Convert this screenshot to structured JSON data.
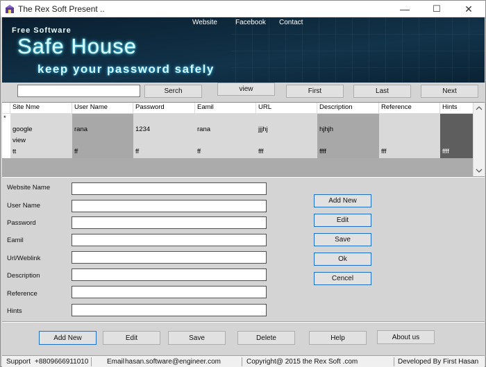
{
  "window": {
    "title": "The Rex Soft Present ..",
    "controls": {
      "minimize": "—",
      "maximize": "☐",
      "close": "✕"
    }
  },
  "banner": {
    "nav": [
      "Website",
      "Facebook",
      "Contact"
    ],
    "free_software": "Free Software",
    "title": "Safe House",
    "tagline": "keep your password safely"
  },
  "search": {
    "value": "",
    "search_label": "Serch",
    "view_label": "view",
    "first_label": "First",
    "last_label": "Last",
    "next_label": "Next"
  },
  "grid": {
    "columns": [
      "Site Nme",
      "User Name",
      "Password",
      "Eamil",
      "URL",
      "Description",
      "Reference",
      "Hints"
    ],
    "new_row_marker": "*",
    "rows": [
      [
        "google",
        "rana",
        "1234",
        "rana",
        "jjjhj",
        "hjhjh",
        "",
        ""
      ],
      [
        "view",
        "",
        "",
        "",
        "",
        "",
        "",
        ""
      ],
      [
        "tt",
        "ff",
        "ff",
        "ff",
        "fff",
        "ffff",
        "fff",
        "ffff"
      ]
    ]
  },
  "form": {
    "fields": [
      {
        "label": "Website Name",
        "value": ""
      },
      {
        "label": "User Name",
        "value": ""
      },
      {
        "label": "Password",
        "value": ""
      },
      {
        "label": "Eamil",
        "value": ""
      },
      {
        "label": "Url/Weblink",
        "value": ""
      },
      {
        "label": "Description",
        "value": ""
      },
      {
        "label": "Reference",
        "value": ""
      },
      {
        "label": "Hints",
        "value": ""
      }
    ],
    "side_buttons": [
      "Add New",
      "Edit",
      "Save",
      "Ok",
      "Cencel"
    ]
  },
  "bottom_buttons": [
    "Add New",
    "Edit",
    "Save",
    "Delete",
    "Help",
    "About us"
  ],
  "status": {
    "support_label": "Support",
    "support_phone": "+8809666911010",
    "email_label": "Email",
    "email": "hasan.software@engineer.com",
    "copyright": "Copyright@ 2015 the Rex Soft .com",
    "developer": "Developed By First Hasan"
  },
  "colors": {
    "banner_bg": "#0e2a3e",
    "banner_glow": "#3fd8ff",
    "accent_border": "#1e6fc8"
  }
}
